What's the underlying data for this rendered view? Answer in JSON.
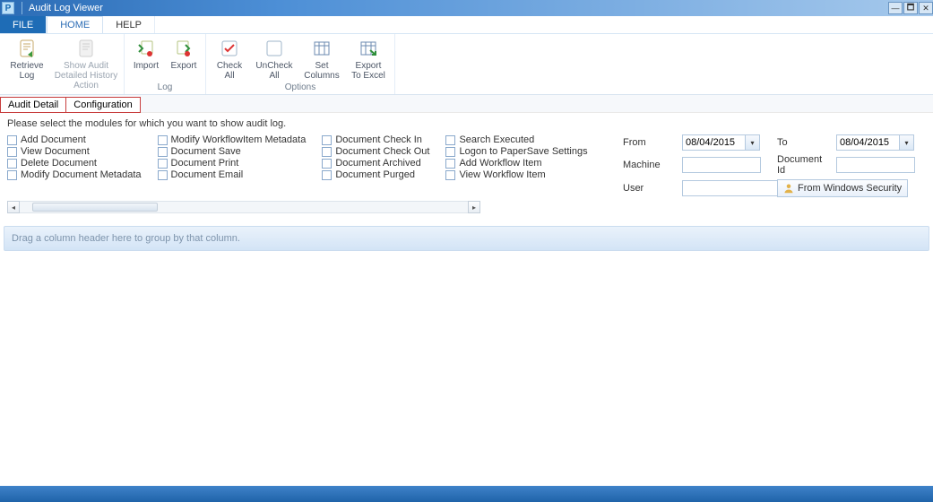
{
  "window": {
    "title": "Audit Log Viewer",
    "app_icon_text": "P"
  },
  "ribbon": {
    "tabs": {
      "file": "FILE",
      "home": "HOME",
      "help": "HELP"
    },
    "groups": [
      {
        "id": "actions",
        "label": "",
        "items": [
          {
            "id": "retrieve-log",
            "label_l1": "Retrieve",
            "label_l2": "Log",
            "disabled": false
          },
          {
            "id": "show-audit",
            "label_l1": "Show Audit",
            "label_l2": "Detailed History",
            "label_l3": "Action",
            "disabled": true
          }
        ]
      },
      {
        "id": "log",
        "label": "Log",
        "items": [
          {
            "id": "import",
            "label_l1": "Import",
            "label_l2": ""
          },
          {
            "id": "export",
            "label_l1": "Export",
            "label_l2": ""
          }
        ]
      },
      {
        "id": "options",
        "label": "Options",
        "items": [
          {
            "id": "check-all",
            "label_l1": "Check",
            "label_l2": "All"
          },
          {
            "id": "uncheck-all",
            "label_l1": "UnCheck",
            "label_l2": "All"
          },
          {
            "id": "set-columns",
            "label_l1": "Set",
            "label_l2": "Columns"
          },
          {
            "id": "export-excel",
            "label_l1": "Export",
            "label_l2": "To Excel"
          }
        ]
      }
    ]
  },
  "subtabs": {
    "audit_detail": "Audit Detail",
    "configuration": "Configuration"
  },
  "filter": {
    "hint": "Please select the modules for which you want to show audit log.",
    "cols": [
      [
        "Add Document",
        "View Document",
        "Delete Document",
        "Modify Document Metadata"
      ],
      [
        "Modify WorkflowItem Metadata",
        "Document Save",
        "Document Print",
        "Document Email"
      ],
      [
        "Document Check In",
        "Document Check Out",
        "Document Archived",
        "Document Purged"
      ],
      [
        "Search Executed",
        "Logon to PaperSave Settings",
        "Add Workflow Item",
        "View Workflow Item"
      ]
    ],
    "labels": {
      "from": "From",
      "to": "To",
      "machine": "Machine",
      "document_id": "Document Id",
      "user": "User"
    },
    "values": {
      "from": "08/04/2015",
      "to": "08/04/2015",
      "machine": "",
      "document_id": "",
      "user": ""
    },
    "from_windows_security": "From Windows Security"
  },
  "grid": {
    "group_hint": "Drag a column header here to group by that column."
  }
}
